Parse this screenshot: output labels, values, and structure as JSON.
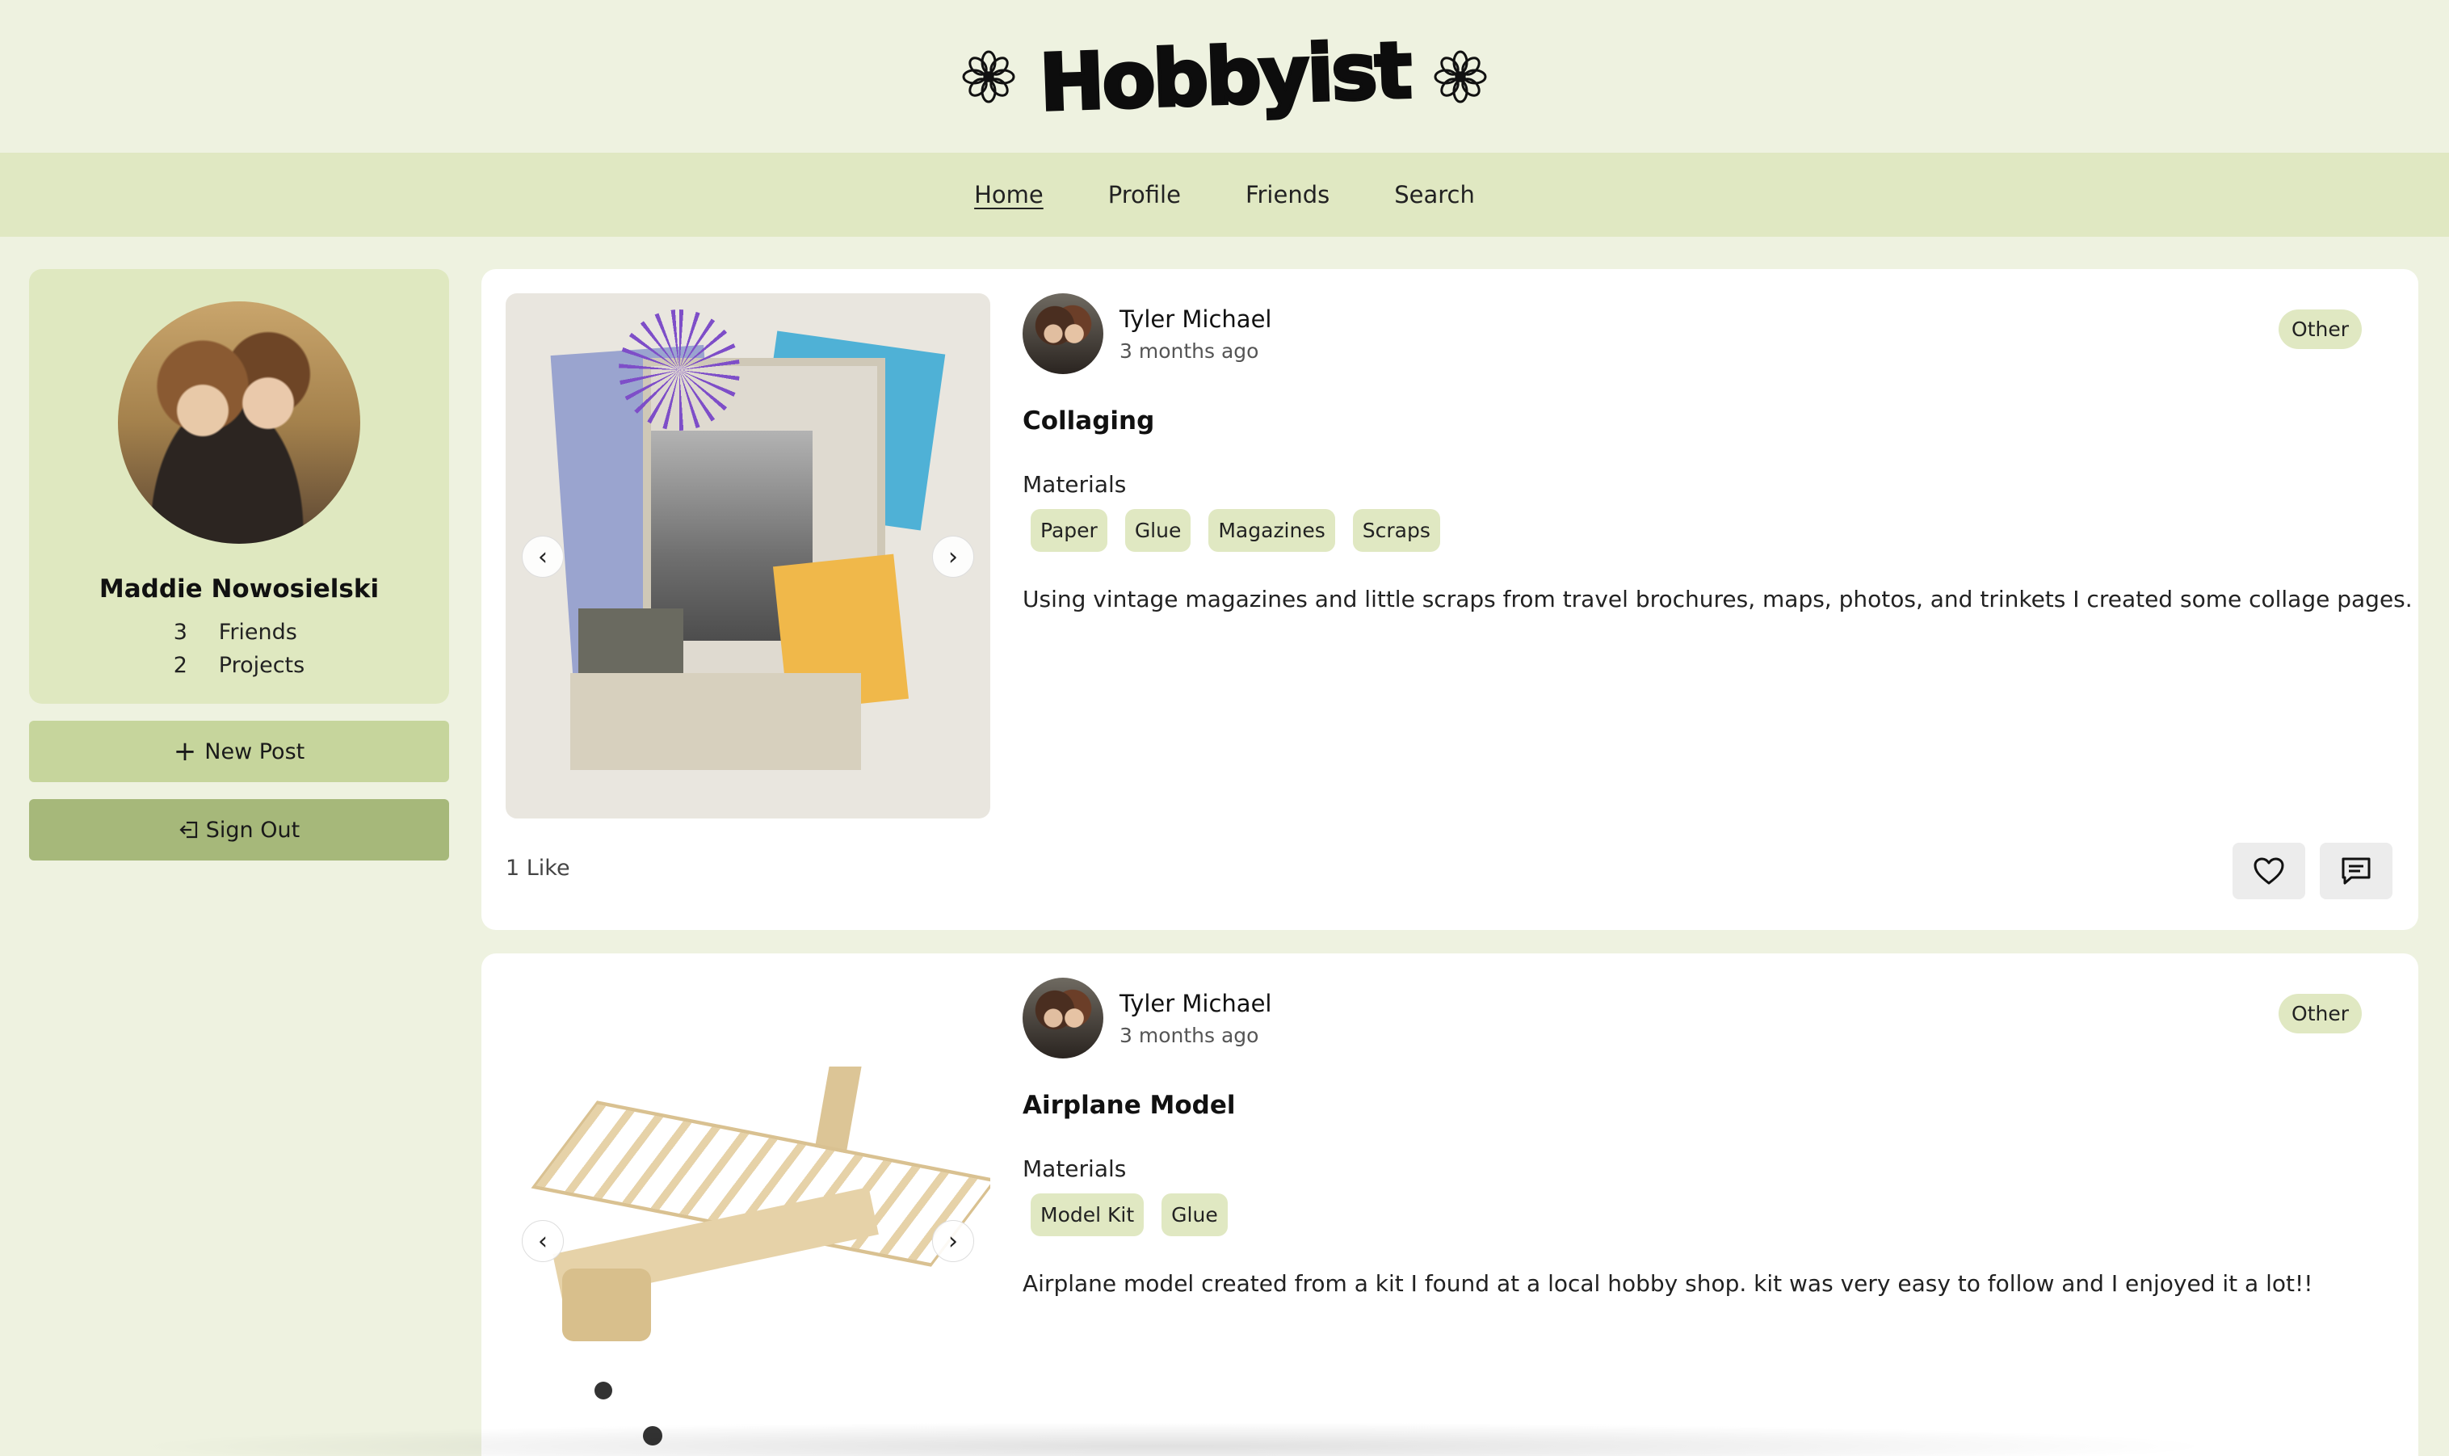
{
  "brand": {
    "title": "Hobbyist",
    "icon": "flower-icon"
  },
  "nav": {
    "items": [
      {
        "label": "Home",
        "active": true
      },
      {
        "label": "Profile"
      },
      {
        "label": "Friends"
      },
      {
        "label": "Search"
      }
    ]
  },
  "profile": {
    "name": "Maddie Nowosielski",
    "friends_count": "3",
    "friends_label": "Friends",
    "projects_count": "2",
    "projects_label": "Projects"
  },
  "sidebar": {
    "new_post_label": "New Post",
    "sign_out_label": "Sign Out"
  },
  "posts": [
    {
      "author": "Tyler Michael",
      "time": "3 months ago",
      "category": "Other",
      "title": "Collaging",
      "materials_label": "Materials",
      "materials": [
        "Paper",
        "Glue",
        "Magazines",
        "Scraps"
      ],
      "description": "Using vintage magazines and little scraps from travel brochures, maps, photos, and trinkets I created some collage pages.",
      "likes": "1 Like"
    },
    {
      "author": "Tyler Michael",
      "time": "3 months ago",
      "category": "Other",
      "title": "Airplane Model",
      "materials_label": "Materials",
      "materials": [
        "Model Kit",
        "Glue"
      ],
      "description": "Airplane model created from a kit I found at a local hobby shop. kit was very easy to follow and I enjoyed it a lot!!"
    }
  ],
  "colors": {
    "page_bg": "#eef2e0",
    "nav_bg": "#e0e8c2",
    "card_bg": "#dfe8c0",
    "new_post_bg": "#c6d59c",
    "sign_out_bg": "#a6b87a",
    "chip_bg": "#e0e8c2"
  }
}
